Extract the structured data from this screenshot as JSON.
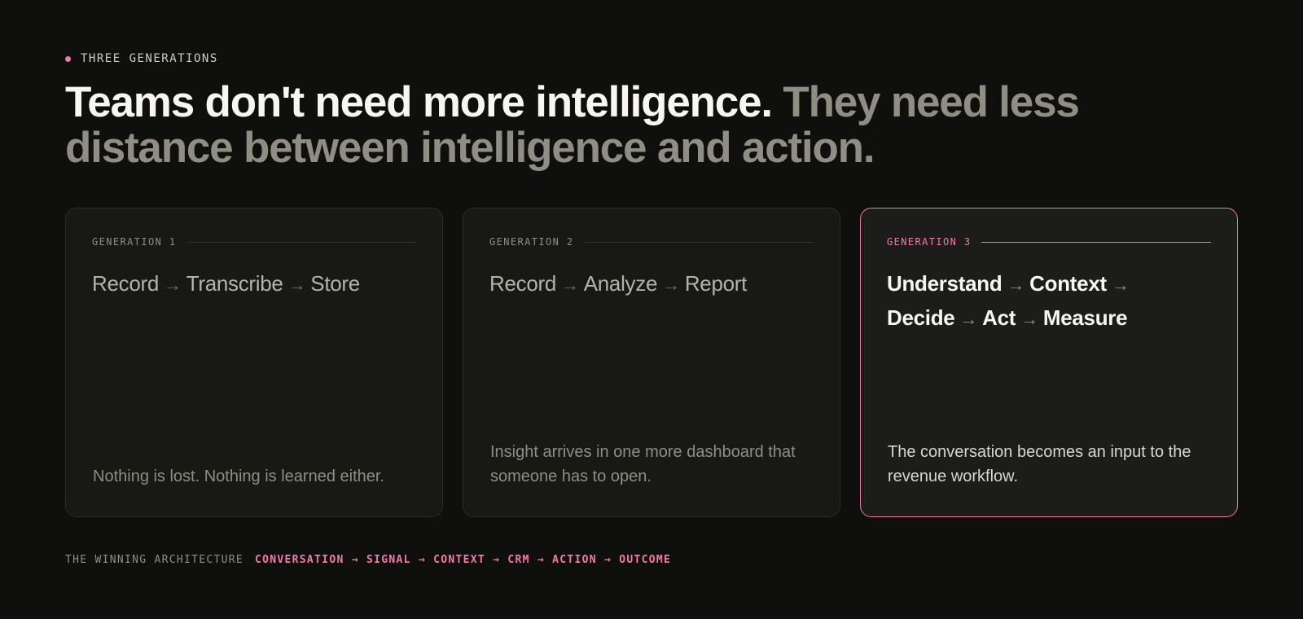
{
  "eyebrow": {
    "text": "THREE GENERATIONS"
  },
  "headline": {
    "strong": "Teams don't need more intelligence.",
    "muted": "They need less distance between intelligence and action."
  },
  "cards": [
    {
      "label": "GENERATION 1",
      "steps": [
        "Record",
        "Transcribe",
        "Store"
      ],
      "description": "Nothing is lost. Nothing is learned either."
    },
    {
      "label": "GENERATION 2",
      "steps": [
        "Record",
        "Analyze",
        "Report"
      ],
      "description": "Insight arrives in one more dashboard that someone has to open."
    },
    {
      "label": "GENERATION 3",
      "steps": [
        "Understand",
        "Context",
        "Decide",
        "Act",
        "Measure"
      ],
      "description": "The conversation becomes an input to the revenue workflow."
    }
  ],
  "footer": {
    "label": "THE WINNING ARCHITECTURE",
    "chain": "CONVERSATION → SIGNAL → CONTEXT → CRM → ACTION → OUTCOME"
  },
  "colors": {
    "accent": "#f17aa8",
    "background": "#0f0f0e",
    "muted": "#8f8d84"
  }
}
